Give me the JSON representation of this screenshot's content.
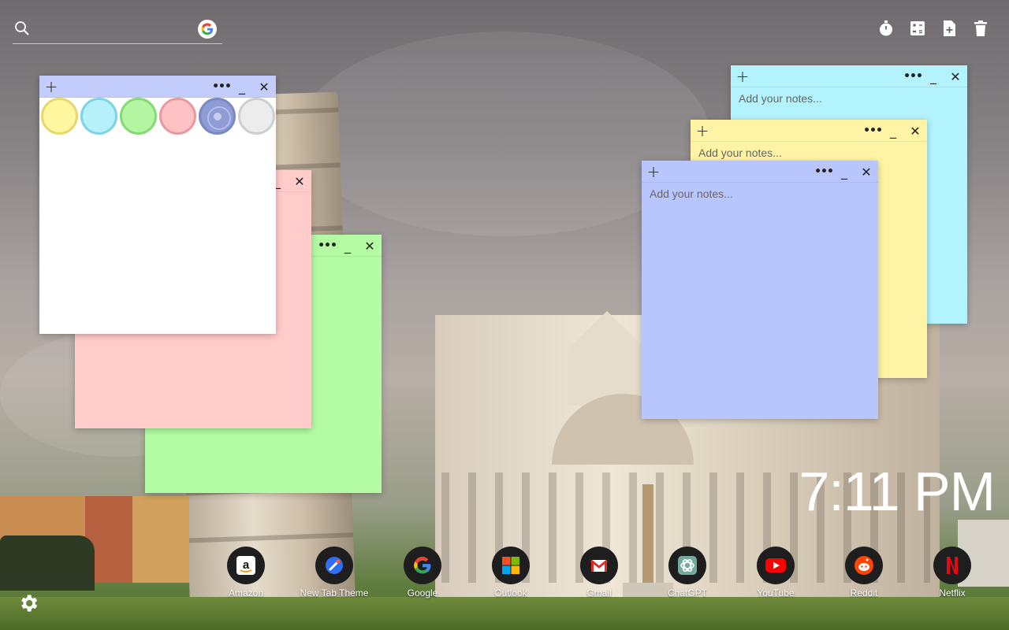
{
  "search": {
    "placeholder": "",
    "icon": "search-icon",
    "engine_icon": "google-icon"
  },
  "toolbar": {
    "tools": [
      {
        "icon": "stopwatch-icon"
      },
      {
        "icon": "calculator-icon"
      },
      {
        "icon": "add-note-icon"
      },
      {
        "icon": "trash-icon"
      }
    ]
  },
  "notes": {
    "placeholder": "Add your notes...",
    "color_picker": {
      "swatches": [
        {
          "name": "yellow",
          "fill": "#fff6a0",
          "ring": "#e5d870"
        },
        {
          "name": "cyan",
          "fill": "#b6f0fa",
          "ring": "#7fd3e3"
        },
        {
          "name": "green",
          "fill": "#b4f5a2",
          "ring": "#86d974"
        },
        {
          "name": "pink",
          "fill": "#ffc2c4",
          "ring": "#e89aa0"
        },
        {
          "name": "blue",
          "fill": "#8e9cd6",
          "ring": "#7b89c2",
          "selected": true
        },
        {
          "name": "gray",
          "fill": "#ececec",
          "ring": "#cfcfcf"
        }
      ]
    },
    "colors": {
      "white": "#ffffff",
      "pink": "#ffcbcb",
      "green": "#b3fca4",
      "cyan": "#b3f3fd",
      "yellow": "#fff4a6",
      "blue": "#b8c6fd",
      "header_blue": "#c2cdfb"
    }
  },
  "clock": {
    "time": "7:11 PM"
  },
  "shortcuts": [
    {
      "label": "Amazon",
      "icon": "amazon-icon"
    },
    {
      "label": "New Tab Theme",
      "icon": "new-tab-theme-icon"
    },
    {
      "label": "Google",
      "icon": "google-icon"
    },
    {
      "label": "Outlook",
      "icon": "outlook-icon"
    },
    {
      "label": "Gmail",
      "icon": "gmail-icon"
    },
    {
      "label": "ChatGPT",
      "icon": "chatgpt-icon"
    },
    {
      "label": "YouTube",
      "icon": "youtube-icon"
    },
    {
      "label": "Reddit",
      "icon": "reddit-icon"
    },
    {
      "label": "Netflix",
      "icon": "netflix-icon"
    }
  ],
  "settings": {
    "icon": "settings-gear-icon"
  }
}
